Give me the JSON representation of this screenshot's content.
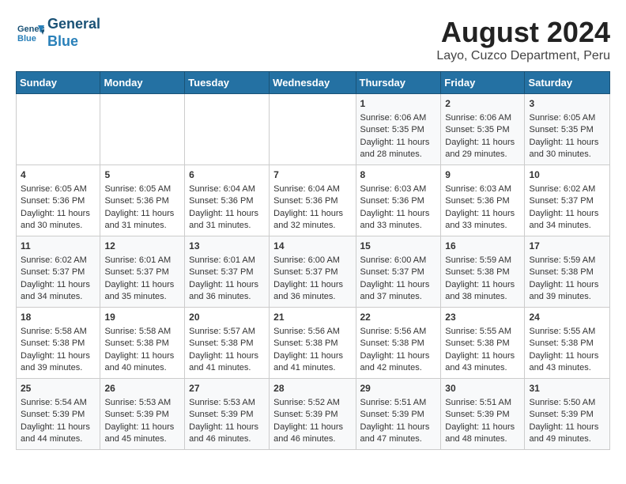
{
  "header": {
    "logo_line1": "General",
    "logo_line2": "Blue",
    "title": "August 2024",
    "subtitle": "Layo, Cuzco Department, Peru"
  },
  "days_of_week": [
    "Sunday",
    "Monday",
    "Tuesday",
    "Wednesday",
    "Thursday",
    "Friday",
    "Saturday"
  ],
  "weeks": [
    [
      {
        "day": "",
        "content": ""
      },
      {
        "day": "",
        "content": ""
      },
      {
        "day": "",
        "content": ""
      },
      {
        "day": "",
        "content": ""
      },
      {
        "day": "1",
        "content": "Sunrise: 6:06 AM\nSunset: 5:35 PM\nDaylight: 11 hours\nand 28 minutes."
      },
      {
        "day": "2",
        "content": "Sunrise: 6:06 AM\nSunset: 5:35 PM\nDaylight: 11 hours\nand 29 minutes."
      },
      {
        "day": "3",
        "content": "Sunrise: 6:05 AM\nSunset: 5:35 PM\nDaylight: 11 hours\nand 30 minutes."
      }
    ],
    [
      {
        "day": "4",
        "content": "Sunrise: 6:05 AM\nSunset: 5:36 PM\nDaylight: 11 hours\nand 30 minutes."
      },
      {
        "day": "5",
        "content": "Sunrise: 6:05 AM\nSunset: 5:36 PM\nDaylight: 11 hours\nand 31 minutes."
      },
      {
        "day": "6",
        "content": "Sunrise: 6:04 AM\nSunset: 5:36 PM\nDaylight: 11 hours\nand 31 minutes."
      },
      {
        "day": "7",
        "content": "Sunrise: 6:04 AM\nSunset: 5:36 PM\nDaylight: 11 hours\nand 32 minutes."
      },
      {
        "day": "8",
        "content": "Sunrise: 6:03 AM\nSunset: 5:36 PM\nDaylight: 11 hours\nand 33 minutes."
      },
      {
        "day": "9",
        "content": "Sunrise: 6:03 AM\nSunset: 5:36 PM\nDaylight: 11 hours\nand 33 minutes."
      },
      {
        "day": "10",
        "content": "Sunrise: 6:02 AM\nSunset: 5:37 PM\nDaylight: 11 hours\nand 34 minutes."
      }
    ],
    [
      {
        "day": "11",
        "content": "Sunrise: 6:02 AM\nSunset: 5:37 PM\nDaylight: 11 hours\nand 34 minutes."
      },
      {
        "day": "12",
        "content": "Sunrise: 6:01 AM\nSunset: 5:37 PM\nDaylight: 11 hours\nand 35 minutes."
      },
      {
        "day": "13",
        "content": "Sunrise: 6:01 AM\nSunset: 5:37 PM\nDaylight: 11 hours\nand 36 minutes."
      },
      {
        "day": "14",
        "content": "Sunrise: 6:00 AM\nSunset: 5:37 PM\nDaylight: 11 hours\nand 36 minutes."
      },
      {
        "day": "15",
        "content": "Sunrise: 6:00 AM\nSunset: 5:37 PM\nDaylight: 11 hours\nand 37 minutes."
      },
      {
        "day": "16",
        "content": "Sunrise: 5:59 AM\nSunset: 5:38 PM\nDaylight: 11 hours\nand 38 minutes."
      },
      {
        "day": "17",
        "content": "Sunrise: 5:59 AM\nSunset: 5:38 PM\nDaylight: 11 hours\nand 39 minutes."
      }
    ],
    [
      {
        "day": "18",
        "content": "Sunrise: 5:58 AM\nSunset: 5:38 PM\nDaylight: 11 hours\nand 39 minutes."
      },
      {
        "day": "19",
        "content": "Sunrise: 5:58 AM\nSunset: 5:38 PM\nDaylight: 11 hours\nand 40 minutes."
      },
      {
        "day": "20",
        "content": "Sunrise: 5:57 AM\nSunset: 5:38 PM\nDaylight: 11 hours\nand 41 minutes."
      },
      {
        "day": "21",
        "content": "Sunrise: 5:56 AM\nSunset: 5:38 PM\nDaylight: 11 hours\nand 41 minutes."
      },
      {
        "day": "22",
        "content": "Sunrise: 5:56 AM\nSunset: 5:38 PM\nDaylight: 11 hours\nand 42 minutes."
      },
      {
        "day": "23",
        "content": "Sunrise: 5:55 AM\nSunset: 5:38 PM\nDaylight: 11 hours\nand 43 minutes."
      },
      {
        "day": "24",
        "content": "Sunrise: 5:55 AM\nSunset: 5:38 PM\nDaylight: 11 hours\nand 43 minutes."
      }
    ],
    [
      {
        "day": "25",
        "content": "Sunrise: 5:54 AM\nSunset: 5:39 PM\nDaylight: 11 hours\nand 44 minutes."
      },
      {
        "day": "26",
        "content": "Sunrise: 5:53 AM\nSunset: 5:39 PM\nDaylight: 11 hours\nand 45 minutes."
      },
      {
        "day": "27",
        "content": "Sunrise: 5:53 AM\nSunset: 5:39 PM\nDaylight: 11 hours\nand 46 minutes."
      },
      {
        "day": "28",
        "content": "Sunrise: 5:52 AM\nSunset: 5:39 PM\nDaylight: 11 hours\nand 46 minutes."
      },
      {
        "day": "29",
        "content": "Sunrise: 5:51 AM\nSunset: 5:39 PM\nDaylight: 11 hours\nand 47 minutes."
      },
      {
        "day": "30",
        "content": "Sunrise: 5:51 AM\nSunset: 5:39 PM\nDaylight: 11 hours\nand 48 minutes."
      },
      {
        "day": "31",
        "content": "Sunrise: 5:50 AM\nSunset: 5:39 PM\nDaylight: 11 hours\nand 49 minutes."
      }
    ]
  ]
}
